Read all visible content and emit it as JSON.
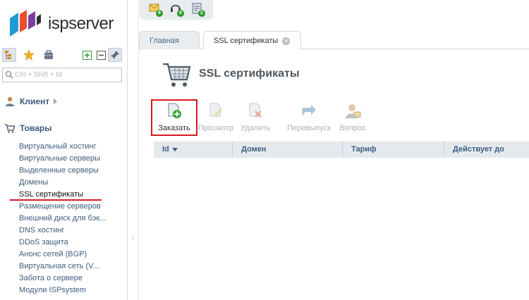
{
  "brand": {
    "name": "ispserver"
  },
  "top_icons": [
    {
      "icon": "notifications-icon",
      "badge": "6"
    },
    {
      "icon": "support-headset-icon",
      "badge": "0"
    },
    {
      "icon": "tasks-icon",
      "badge": "2"
    }
  ],
  "search": {
    "placeholder": "Ctrl + Shift + M"
  },
  "sidebar": {
    "client_label": "Клиент",
    "goods_label": "Товары",
    "items": [
      "Виртуальный хостинг",
      "Виртуальные серверы",
      "Выделенные серверы",
      "Домены",
      "SSL сертификаты",
      "Размещение серверов",
      "Внешний диск для бэк...",
      "DNS хостинг",
      "DDoS защита",
      "Анонс сетей (BGP)",
      "Виртуальная сеть (V...",
      "Забота о сервере",
      "Модули ISPsystem"
    ],
    "current_index": 4
  },
  "tabs": [
    {
      "label": "Главная"
    },
    {
      "label": "SSL сертификаты"
    }
  ],
  "page": {
    "title": "SSL сертификаты"
  },
  "toolbar": {
    "order": "Заказать",
    "view": "Просмотр",
    "delete": "Удалить",
    "reissue": "Перевыпуск",
    "question": "Вопрос"
  },
  "table": {
    "columns": [
      "Id",
      "Домен",
      "Тариф",
      "Действует до"
    ],
    "sort_column": "Id",
    "sort_direction": "desc"
  },
  "colors": {
    "accent": "#3d5d7e",
    "highlight": "#d71920",
    "badge": "#2e9a2e"
  }
}
